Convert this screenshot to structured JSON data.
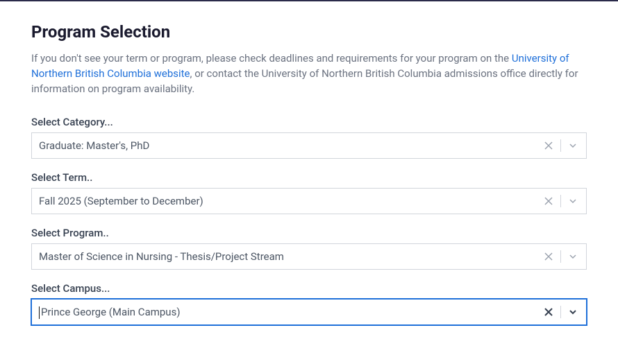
{
  "heading": "Program Selection",
  "intro": {
    "before_link": "If you don't see your term or program, please check deadlines and requirements for your program on the ",
    "link_text": "University of Northern British Columbia website",
    "after_link": ", or contact the University of Northern British Columbia admissions office directly for information on program availability."
  },
  "fields": {
    "category": {
      "label": "Select Category...",
      "value": "Graduate: Master's, PhD"
    },
    "term": {
      "label": "Select Term..",
      "value": "Fall 2025 (September to December)"
    },
    "program": {
      "label": "Select Program..",
      "value": "Master of Science in Nursing - Thesis/Project Stream"
    },
    "campus": {
      "label": "Select Campus...",
      "value": "Prince George (Main Campus)"
    }
  }
}
